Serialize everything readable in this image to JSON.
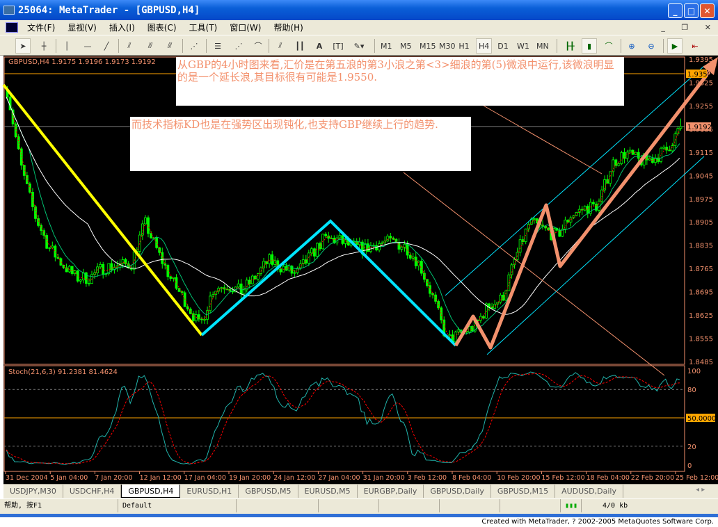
{
  "window": {
    "title": "25064: MetaTrader - [GBPUSD,H4]"
  },
  "menu": [
    "文件(F)",
    "显视(V)",
    "插入(I)",
    "图表(C)",
    "工具(T)",
    "窗口(W)",
    "帮助(H)"
  ],
  "toolbar": {
    "tools": [
      "cursor-icon",
      "crosshair-icon",
      "vertical-line-icon",
      "horizontal-line-icon",
      "trendline-icon",
      "channel-icon",
      "equidistant-channel-icon",
      "std-deviation-channel-icon",
      "gann-fan-icon",
      "fibo-retracement-icon",
      "fibo-fan-icon",
      "fibo-arcs-icon",
      "parallel-lines-icon",
      "cycle-lines-icon",
      "text-icon",
      "text-label-icon",
      "arrows-icon"
    ],
    "text_tool": "A",
    "timeframes": [
      "M1",
      "M5",
      "M15",
      "M30",
      "H1",
      "H4",
      "D1",
      "W1",
      "MN"
    ],
    "active_timeframe": "H4",
    "chart_buttons": [
      "bar-chart-icon",
      "candlestick-icon",
      "line-chart-icon",
      "zoom-in-icon",
      "zoom-out-icon",
      "autoscroll-icon",
      "chart-shift-icon"
    ]
  },
  "chart": {
    "header": "GBPUSD,H4  1.9175 1.9196 1.9173 1.9192",
    "price_labels": [
      "1.9395",
      "1.9325",
      "1.9255",
      "1.9185",
      "1.9115",
      "1.9045",
      "1.8975",
      "1.8905",
      "1.8835",
      "1.8765",
      "1.8695",
      "1.8625",
      "1.8555",
      "1.8485"
    ],
    "current_price": "1.9192",
    "level_price": "1.9350",
    "annotation_1": "从GBP的4小时图来看,汇价是在第五浪的第3小浪之第<3>细浪的第(5)微浪中运行,该微浪明显的是一个延长浪,其目标很有可能是1.9550.",
    "annotation_2": "而技术指标KD也是在强势区出现钝化,也支持GBP继续上行的趋势.",
    "close_path": [
      1.9301,
      1.9071,
      1.8925,
      1.8831,
      1.8778,
      1.8737,
      1.8737,
      1.8768,
      1.8774,
      1.8778,
      1.8904,
      1.881,
      1.8726,
      1.8664,
      1.859,
      1.8705,
      1.8716,
      1.8695,
      1.8737,
      1.8789,
      1.8768,
      1.8747,
      1.8799,
      1.8852,
      1.8852,
      1.8831,
      1.8824,
      1.8841,
      1.8845,
      1.8831,
      1.8778,
      1.8674,
      1.8548,
      1.857,
      1.859,
      1.8653,
      1.8674,
      1.8799,
      1.8904,
      1.8883,
      1.8862,
      1.8925,
      1.8946,
      1.8956,
      1.9081,
      1.9113,
      1.9088,
      1.9096,
      1.9123,
      1.9192
    ],
    "price_range": [
      1.8485,
      1.9395
    ],
    "colors": {
      "bull": "#00ff00",
      "bear": "#00ff00",
      "ma_fast": "#ff0000",
      "ma_mid": "#00c070",
      "ma_slow": "#ffffff",
      "axis": "#f3916d",
      "wave_a": "#ffff00",
      "wave_b": "#00e5ff",
      "wave_c": "#f3916d"
    }
  },
  "stoch": {
    "header": "Stoch(21,6,3) 91.2381 81.4624",
    "labels": [
      "100",
      "80",
      "50.0000",
      "20",
      "0"
    ],
    "k_color": "#20b2aa",
    "d_color": "#ff0000"
  },
  "time_labels": [
    "31 Dec 2004",
    "5 Jan 04:00",
    "7 Jan 20:00",
    "12 Jan 12:00",
    "17 Jan 04:00",
    "19 Jan 20:00",
    "24 Jan 12:00",
    "27 Jan 04:00",
    "31 Jan 20:00",
    "3 Feb 12:00",
    "8 Feb 04:00",
    "10 Feb 20:00",
    "15 Feb 12:00",
    "18 Feb 04:00",
    "22 Feb 20:00",
    "25 Feb 12:00"
  ],
  "tabs": [
    "USDJPY,M30",
    "USDCHF,H4",
    "GBPUSD,H4",
    "EURUSD,H1",
    "GBPUSD,M5",
    "EURUSD,M5",
    "EURGBP,Daily",
    "GBPUSD,Daily",
    "GBPUSD,M15",
    "AUDUSD,Daily"
  ],
  "active_tab": "GBPUSD,H4",
  "status": {
    "help": "帮助, 按F1",
    "profile": "Default",
    "traffic": "4/0 kb"
  },
  "credit": "Created with MetaTrader, ? 2002-2005 MetaQuotes Software Corp."
}
